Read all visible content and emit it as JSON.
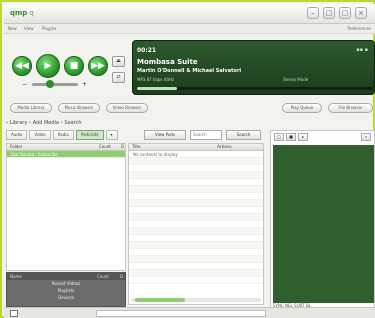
{
  "app": {
    "name": "qmp",
    "suffix": "q"
  },
  "menu": {
    "file": "New",
    "view": "View",
    "plugins": "Plugins",
    "right": "Preferences"
  },
  "window": {
    "btn1": "–",
    "btn2": "□",
    "btn3": "▢",
    "btn4": "×"
  },
  "player": {
    "prev": "◀◀",
    "play": "▶",
    "stop": "■",
    "next": "▶▶",
    "vol_minus": "−",
    "vol_plus": "+",
    "eject": "⏏",
    "shuffle": "⇄",
    "volume_fraction": 0.4
  },
  "nowplaying": {
    "time": "00:21",
    "title": "Mombasa Suite",
    "artist": "Martin O'Donnell & Michael Salvatori",
    "meta": "MP3 87 kbps 44Hz",
    "meta2": "Stereo Mode",
    "progress_fraction": 0.17,
    "dots": "▪▪ ▪"
  },
  "pills": {
    "media_library": "Media Library",
    "music_browser": "Music Browser",
    "video_browser": "Video Browser",
    "play_queue": "Play Queue",
    "file_browser": "File Browser"
  },
  "breadcrumb": {
    "library": "Library",
    "add_media": "Add Media",
    "search": "Search"
  },
  "tabs": [
    "Audio",
    "Video",
    "Radio",
    "Podcasts"
  ],
  "toolbar": {
    "dropdown": "▾",
    "view_podcasts": "View Pods",
    "search_placeholder": "Search",
    "search_button": "Search"
  },
  "leftpane": {
    "col_folder": "Folder",
    "col_count": "Count",
    "col_sort": "D",
    "selected_item": "Get Started / Subscribe"
  },
  "leftbottom": {
    "col_name": "Name",
    "col_count": "Count",
    "col_sort": "D",
    "items": [
      "Recent Videos",
      "Playlists",
      "Devices"
    ]
  },
  "midpane": {
    "col_title": "Title",
    "col_actions": "Actions",
    "empty": "No contents to display"
  },
  "rightpane": {
    "t1": "□",
    "t2": "■",
    "t3": "▸",
    "t4": "⌕",
    "footer": "SYNC NEL  SORT BL"
  }
}
